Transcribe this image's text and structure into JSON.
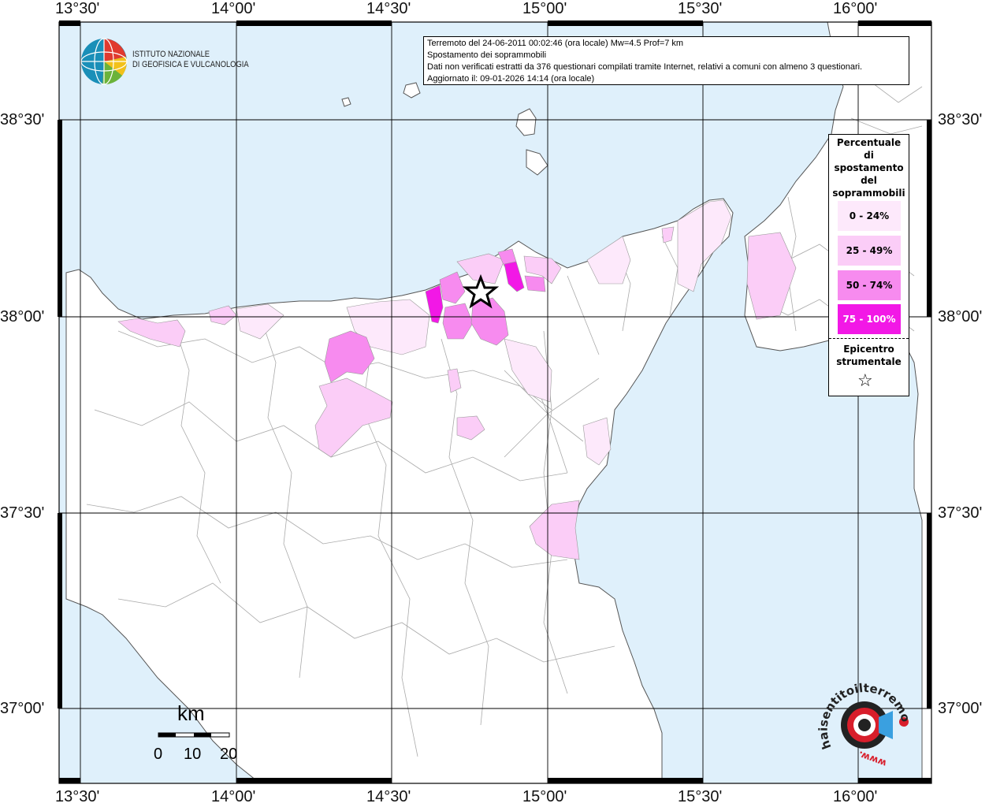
{
  "header": {
    "line1": "Terremoto del 24-06-2011 00:02:46 (ora locale) Mw=4.5 Prof=7 km",
    "line2": "Spostamento dei soprammobili",
    "line3": "Dati non verificati estratti da 376 questionari compilati tramite Internet, relativi a comuni con almeno 3 questionari.",
    "line4": "Aggiornato il: 09-01-2026 14:14 (ora locale)"
  },
  "axes": {
    "lon_labels": [
      "13°30'",
      "14°00'",
      "14°30'",
      "15°00'",
      "15°30'",
      "16°00'"
    ],
    "lat_labels": [
      "38°30'",
      "38°00'",
      "37°30'",
      "37°00'"
    ]
  },
  "logo": {
    "line1": "ISTITUTO NAZIONALE",
    "line2": "DI GEOFISICA E VULCANOLOGIA"
  },
  "legend": {
    "title_lines": [
      "Percentuale",
      "di",
      "spostamento",
      "del",
      "soprammobili"
    ],
    "classes": [
      {
        "label": "0 - 24%",
        "color": "#fde9fb"
      },
      {
        "label": "25 - 49%",
        "color": "#fbcdf7"
      },
      {
        "label": "50 - 74%",
        "color": "#f78bef"
      },
      {
        "label": "75 - 100%",
        "color": "#f218e6"
      }
    ],
    "epicenter_lines": [
      "Epicentro",
      "strumentale"
    ],
    "epicenter_symbol": "☆"
  },
  "scale": {
    "unit": "km",
    "ticks": [
      "0",
      "10",
      "20"
    ]
  },
  "watermark": {
    "text": "haisentitoilterremoto.it",
    "url": "www."
  },
  "colors": {
    "sea": "#dff0fb",
    "land": "#ffffff",
    "grid": "#000000"
  }
}
